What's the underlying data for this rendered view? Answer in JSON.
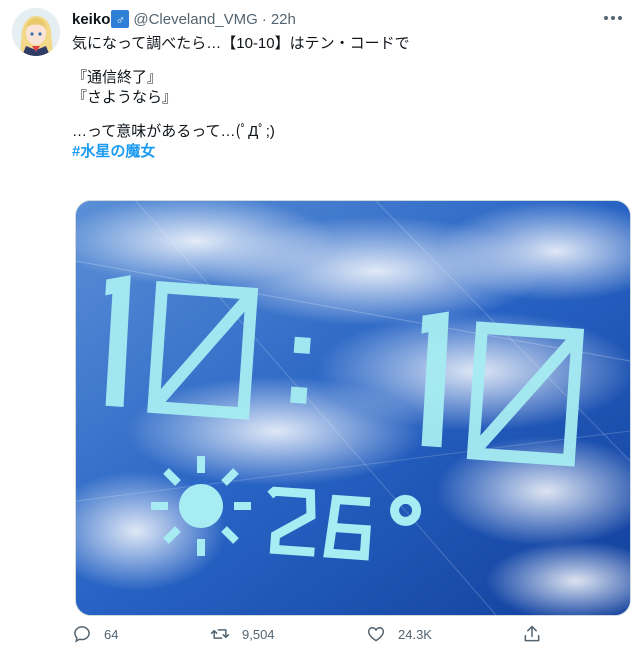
{
  "tweet": {
    "display_name": "keiko",
    "badge_glyph": "♂",
    "handle": "@Cleveland_VMG",
    "separator": "·",
    "time": "22h",
    "lines": [
      "気になって調べたら…【10-10】はテン・コードで",
      "『通信終了』",
      "『さようなら』",
      "…って意味があるって…(ﾟДﾟ;)",
      "#水星の魔女"
    ],
    "image": {
      "clock": "10:10",
      "temperature": "26°",
      "weather_icon": "sun-icon"
    }
  },
  "actions": {
    "reply_count": "64",
    "retweet_count": "9,504",
    "like_count": "24.3K"
  },
  "colors": {
    "accent": "#1d9bf0",
    "muted": "#536471",
    "image_sky": "#1b56b8",
    "display_cyan": "#9fe6ee"
  }
}
